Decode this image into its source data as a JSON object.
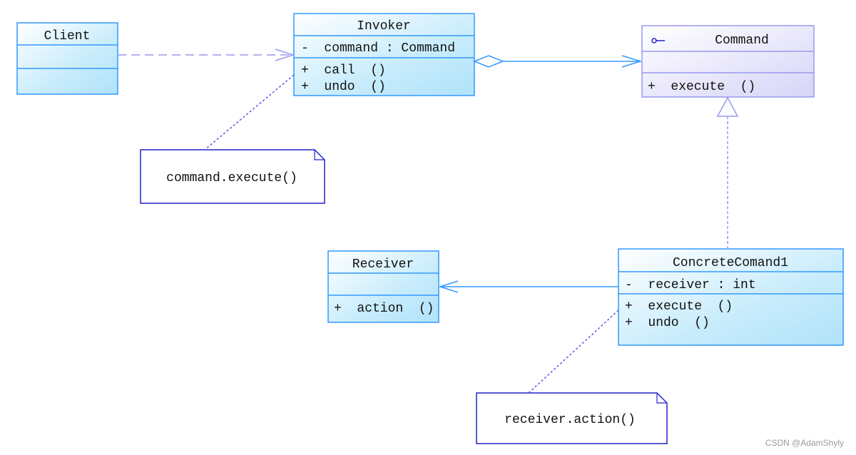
{
  "classes": {
    "client": {
      "name": "Client"
    },
    "invoker": {
      "name": "Invoker",
      "attributes": [
        "-  command : Command"
      ],
      "operations": [
        "+  call  ()",
        "+  undo  ()"
      ]
    },
    "command": {
      "name": "Command",
      "stereotype_icon": "interface-lollipop-icon",
      "operations": [
        "+  execute  ()"
      ]
    },
    "receiver": {
      "name": "Receiver",
      "operations": [
        "+  action  ()"
      ]
    },
    "concrete": {
      "name": "ConcreteComand1",
      "attributes": [
        "-  receiver : int"
      ],
      "operations": [
        "+  execute  ()",
        "+  undo  ()"
      ]
    }
  },
  "notes": {
    "invoker_note": "command.execute()",
    "concrete_note": "receiver.action()"
  },
  "watermark": "CSDN @AdamShyly",
  "colors": {
    "class_border": "#3399ff",
    "interface_border": "#9999ee",
    "note_border": "#2222cc",
    "note_link": "#5555ee"
  }
}
